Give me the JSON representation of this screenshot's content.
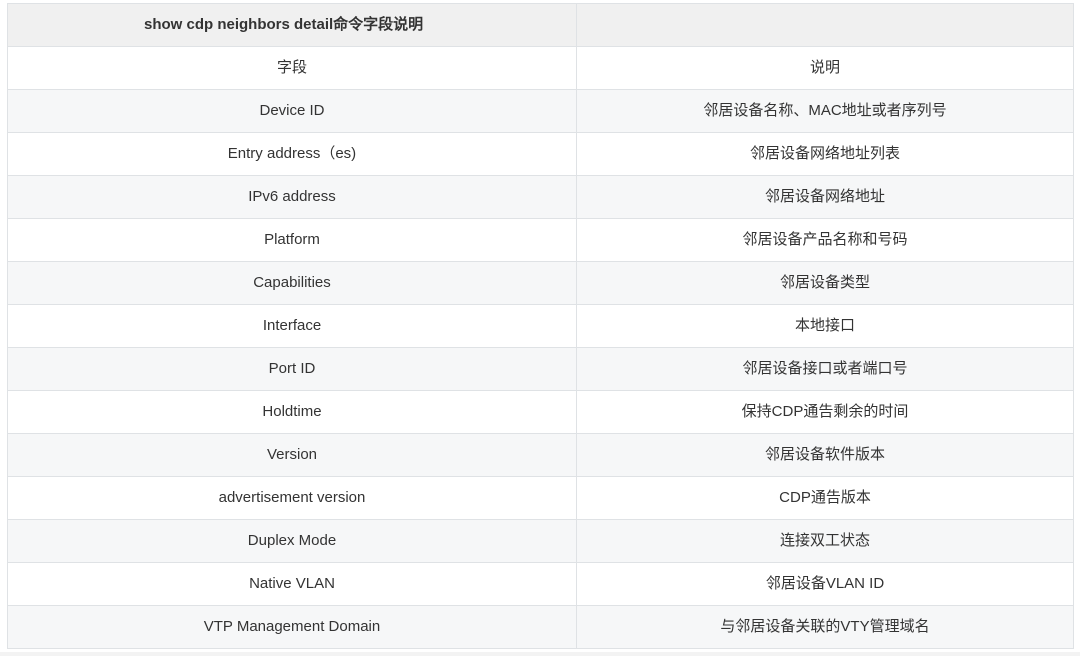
{
  "table": {
    "header": {
      "title": "show cdp neighbors detail命令字段说明",
      "second": ""
    },
    "rows": [
      {
        "field": "字段",
        "desc": "说明"
      },
      {
        "field": "Device ID",
        "desc": "邻居设备名称、MAC地址或者序列号"
      },
      {
        "field": "Entry address（es)",
        "desc": "邻居设备网络地址列表"
      },
      {
        "field": "IPv6 address",
        "desc": "邻居设备网络地址"
      },
      {
        "field": "Platform",
        "desc": "邻居设备产品名称和号码"
      },
      {
        "field": "Capabilities",
        "desc": "邻居设备类型"
      },
      {
        "field": "Interface",
        "desc": "本地接口"
      },
      {
        "field": "Port ID",
        "desc": "邻居设备接口或者端口号"
      },
      {
        "field": "Holdtime",
        "desc": "保持CDP通告剩余的时间"
      },
      {
        "field": "Version",
        "desc": "邻居设备软件版本"
      },
      {
        "field": "advertisement version",
        "desc": "CDP通告版本"
      },
      {
        "field": "Duplex Mode",
        "desc": "连接双工状态"
      },
      {
        "field": "Native VLAN",
        "desc": "邻居设备VLAN ID"
      },
      {
        "field": "VTP Management Domain",
        "desc": "与邻居设备关联的VTY管理域名"
      }
    ]
  }
}
